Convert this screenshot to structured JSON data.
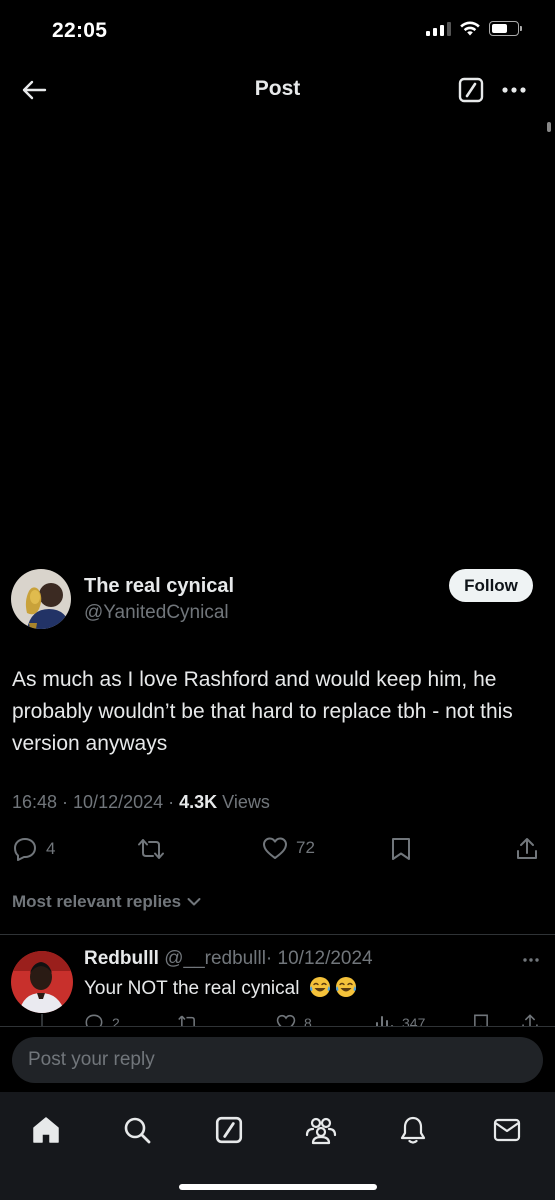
{
  "status_bar": {
    "time": "22:05"
  },
  "header": {
    "title": "Post"
  },
  "post": {
    "author": {
      "name": "The real cynical",
      "handle": "@YanitedCynical"
    },
    "follow_label": "Follow",
    "text": "As much as I love Rashford and would keep him, he probably wouldn’t be that hard to replace tbh - not this version anyways",
    "timestamp": "16:48 · 10/12/2024 · ",
    "views_count": "4.3K",
    "views_label": " Views",
    "stats": {
      "replies": "4",
      "likes": "72"
    }
  },
  "replies_filter": {
    "label": "Most relevant replies"
  },
  "reply": {
    "name": "Redbulll",
    "handle": "@__redbulll",
    "date": "· 10/12/2024",
    "text": "Your NOT the real cynical",
    "stats": {
      "replies": "2",
      "likes": "8",
      "views": "347"
    }
  },
  "compose": {
    "placeholder": "Post your reply"
  },
  "nav": {
    "items": [
      {
        "icon": "home-icon",
        "active": true
      },
      {
        "icon": "search-icon",
        "active": false
      },
      {
        "icon": "grok-icon",
        "active": false
      },
      {
        "icon": "communities-icon",
        "active": false
      },
      {
        "icon": "notifications-icon",
        "active": false
      },
      {
        "icon": "messages-icon",
        "active": false
      }
    ]
  },
  "colors": {
    "background": "#000000",
    "text_primary": "#e7e9ea",
    "text_secondary": "#71767b",
    "follow_bg": "#eff3f4",
    "input_bg": "#202327",
    "nav_bg": "#16181c"
  }
}
